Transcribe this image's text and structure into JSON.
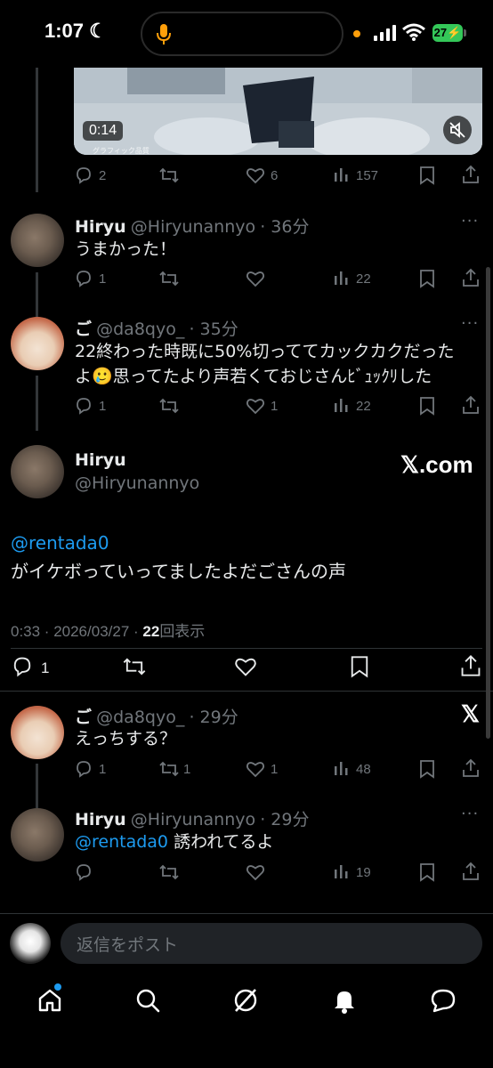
{
  "status_bar": {
    "time": "1:07",
    "battery": "27"
  },
  "video": {
    "duration": "0:14",
    "caption": "グラフィック品質"
  },
  "tweet_top_stats": {
    "replies": "2",
    "likes": "6",
    "views": "157"
  },
  "reply1": {
    "name": "Hiryu",
    "handle": "@Hiryunannyo",
    "time": "· 36分",
    "text": "うまかった！",
    "replies": "1",
    "views": "22"
  },
  "reply2": {
    "name": "ご",
    "handle": "@da8qyo_",
    "time": "· 35分",
    "line1": "22終わった時既に50%切っててカックカクだった",
    "line2_a": "よ",
    "emoji": "🥲",
    "line2_b": "思ってたより声若くておじさんﾋﾞｭｯｸﾘした",
    "replies": "1",
    "likes": "1",
    "views": "22"
  },
  "main_tweet": {
    "name": "Hiryu",
    "handle": "@Hiryunannyo",
    "watermark": "𝕏.com",
    "mention": "@rentada0",
    "text": "がイケボっていってましたよだごさんの声",
    "meta": "0:33 · 2026/03/27 · ",
    "views_count": "22",
    "views_label": "回表示",
    "replies": "1"
  },
  "reply3": {
    "name": "ご",
    "handle": "@da8qyo_",
    "time": "· 29分",
    "text": "えっちする？",
    "x_icon": "𝕏",
    "replies": "1",
    "reposts": "1",
    "likes": "1",
    "views": "48"
  },
  "reply4": {
    "name": "Hiryu",
    "handle": "@Hiryunannyo",
    "time": "· 29分",
    "mention": "@rentada0",
    "text": "誘われてるよ",
    "views": "19"
  },
  "composer": {
    "placeholder": "返信をポスト"
  },
  "more_label": "···"
}
